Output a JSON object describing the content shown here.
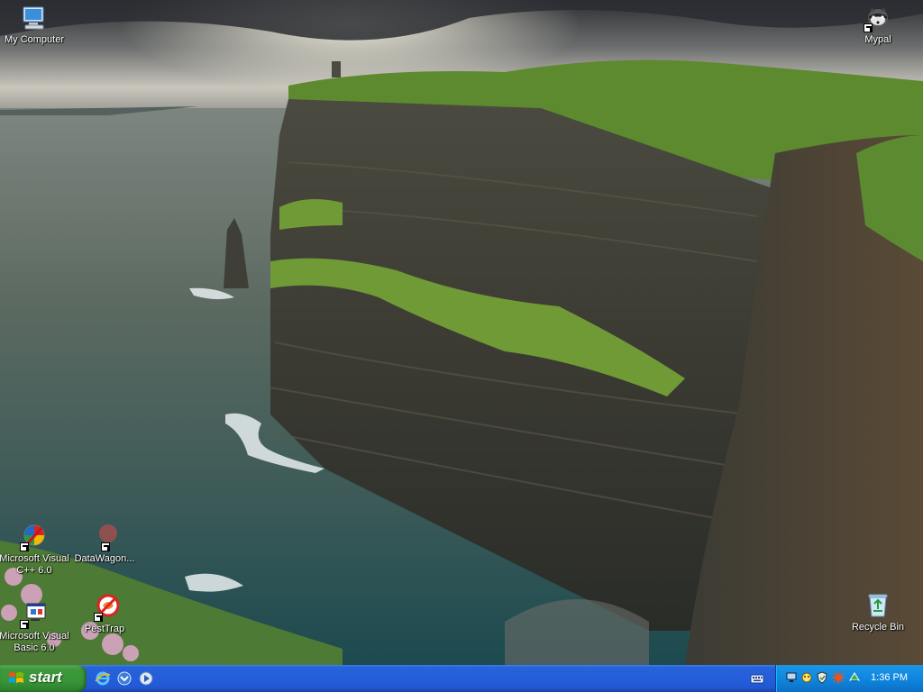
{
  "desktop": {
    "icons": [
      {
        "label": "My Computer",
        "icon": "my-computer-icon"
      },
      {
        "label": "Mypal",
        "icon": "mypal-icon"
      },
      {
        "label": "Microsoft Visual C++ 6.0",
        "icon": "visual-cpp-icon"
      },
      {
        "label": "DataWagon...",
        "icon": "datawagon-icon"
      },
      {
        "label": "Microsoft Visual Basic 6.0",
        "icon": "visual-basic-icon"
      },
      {
        "label": "PestTrap",
        "icon": "pesttrap-icon"
      },
      {
        "label": "Recycle Bin",
        "icon": "recycle-bin-icon"
      }
    ]
  },
  "taskbar": {
    "start_label": "start",
    "quick_launch": [
      "internet-explorer-icon",
      "outlook-express-icon",
      "media-player-icon"
    ],
    "tray_icons": [
      "keyboard-icon",
      "network-icon",
      "security-icon",
      "antivirus-icon",
      "virus-alert-icon",
      "tray-app-icon"
    ],
    "clock": "1:36 PM"
  },
  "colors": {
    "taskbar_blue": "#245edb",
    "start_green": "#379537",
    "tray_blue": "#0f87e0"
  }
}
